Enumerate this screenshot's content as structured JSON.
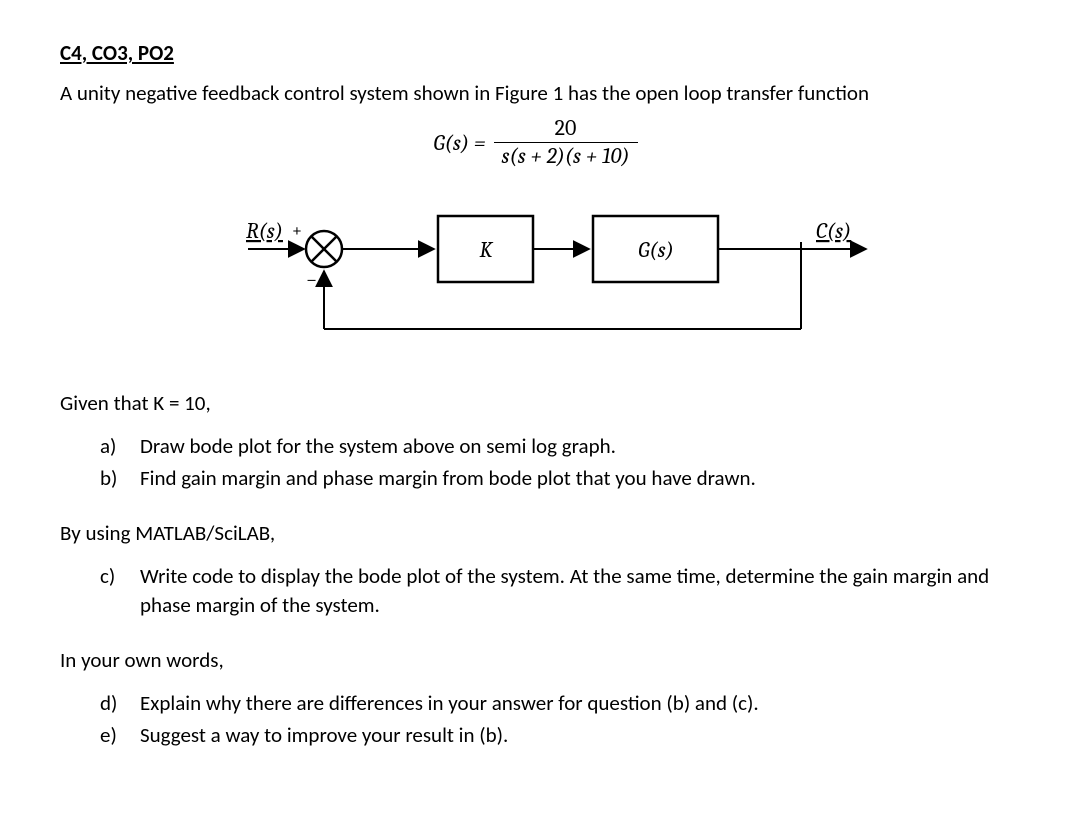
{
  "header": "C4, CO3, PO2",
  "intro": "A unity negative feedback control system shown in Figure 1 has the open loop transfer function",
  "equation": {
    "lhs": "G(s) =",
    "numerator": "20",
    "denominator": "s(s + 2)(s + 10)"
  },
  "diagram": {
    "input_label": "R(s)",
    "plus_sign": "+",
    "minus_sign": "−",
    "block1": "K",
    "block2": "G(s)",
    "output_label": "C(s)"
  },
  "given": "Given that K = 10,",
  "part_a": {
    "marker": "a)",
    "text": "Draw bode plot for the system above on semi log graph."
  },
  "part_b": {
    "marker": "b)",
    "text": "Find gain margin and phase margin from bode plot that you have drawn."
  },
  "section2_header": "By using MATLAB/SciLAB,",
  "part_c": {
    "marker": "c)",
    "text": "Write code to display the bode plot of the system. At the same time, determine the gain margin and phase margin of the system."
  },
  "section3_header": "In your own words,",
  "part_d": {
    "marker": "d)",
    "text": "Explain why there are differences in your answer for question (b) and (c)."
  },
  "part_e": {
    "marker": "e)",
    "text": "Suggest a way to improve your result in (b)."
  }
}
